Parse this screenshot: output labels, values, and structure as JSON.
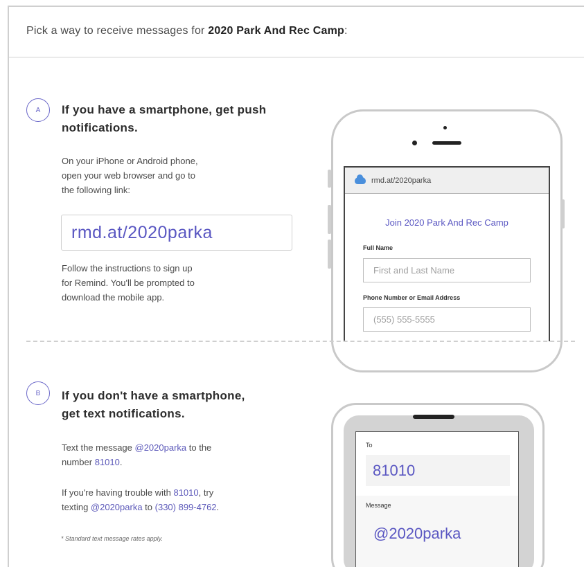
{
  "header": {
    "prefix": "Pick a way to receive messages for ",
    "class_name": "2020 Park And Rec Camp",
    "suffix": ":"
  },
  "section_a": {
    "badge": "A",
    "title_line1": "If you have a smartphone, get push",
    "title_line2": "notifications.",
    "instructions_line1": "On your iPhone or Android phone,",
    "instructions_line2": "open your web browser and go to",
    "instructions_line3": "the following link:",
    "link": "rmd.at/2020parka",
    "follow_line1": "Follow the instructions to sign up",
    "follow_line2": "for Remind. You'll be prompted to",
    "follow_line3": "download the mobile app.",
    "phone": {
      "url": "rmd.at/2020parka",
      "join_title": "Join 2020 Park And Rec Camp",
      "full_name_label": "Full Name",
      "full_name_placeholder": "First and Last Name",
      "contact_label": "Phone Number or Email Address",
      "contact_placeholder": "(555) 555-5555"
    }
  },
  "section_b": {
    "badge": "B",
    "title_line1": "If you don't have a smartphone,",
    "title_line2": "get text notifications.",
    "text_prefix": "Text the message ",
    "text_code": "@2020parka",
    "text_middle": " to the",
    "text_number_prefix": "number ",
    "text_number": "81010",
    "text_end": ".",
    "trouble_prefix": "If you're having trouble with ",
    "trouble_number": "81010",
    "trouble_middle": ", try",
    "trouble_texting": "texting ",
    "trouble_code": "@2020parka",
    "trouble_to": " to ",
    "trouble_alt_number": "(330) 899-4762",
    "trouble_end": ".",
    "note": "* Standard text message rates apply.",
    "phone": {
      "to_label": "To",
      "to_value": "81010",
      "message_label": "Message",
      "message_value": "@2020parka"
    }
  },
  "colors": {
    "accent": "#5a57c2",
    "border": "#cfcfcf"
  }
}
